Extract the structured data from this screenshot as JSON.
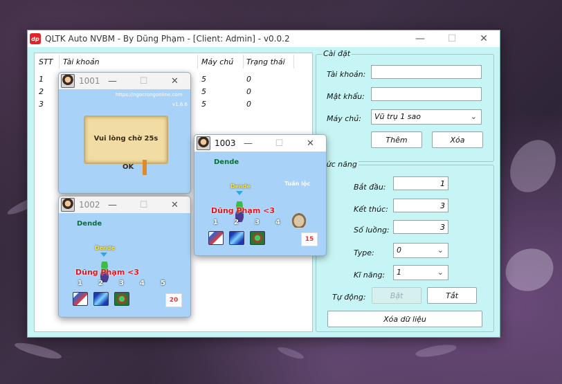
{
  "app": {
    "title": "QLTK Auto NVBM - By Dũng Phạm - [Client: Admin] - v0.0.2",
    "logo_text": "dp"
  },
  "table": {
    "columns": [
      "STT",
      "Tài khoản",
      "Máy chủ",
      "Trạng thái"
    ],
    "rows": [
      {
        "stt": "1",
        "account": "",
        "server": "5",
        "status": "0"
      },
      {
        "stt": "2",
        "account": "",
        "server": "5",
        "status": "0"
      },
      {
        "stt": "3",
        "account": "",
        "server": "5",
        "status": "0"
      }
    ]
  },
  "settings": {
    "title": "Cài đặt",
    "account_label": "Tài khoản:",
    "account_value": "",
    "password_label": "Mật khẩu:",
    "password_value": "",
    "server_label": "Máy chủ:",
    "server_value": "Vũ trụ 1 sao",
    "add_button": "Thêm",
    "delete_button": "Xóa"
  },
  "functions": {
    "title": "Chức năng",
    "start_label": "Bắt đầu:",
    "start_value": "1",
    "end_label": "Kết thúc:",
    "end_value": "3",
    "threads_label": "Số luồng:",
    "threads_value": "3",
    "type_label": "Type:",
    "type_value": "0",
    "skill_label": "Kĩ năng:",
    "skill_value": "1",
    "auto_label": "Tự động:",
    "on_button": "Bật",
    "off_button": "Tắt",
    "clear_button": "Xóa dữ liệu"
  },
  "game_windows": [
    {
      "title": "1001",
      "url": "https://ngocrongonline.com",
      "version": "v1.6.6",
      "dialog_text": "Vui lòng chờ 25s",
      "ok_label": "OK"
    },
    {
      "title": "1002",
      "npc_name": "Dende",
      "char_label": "Dende",
      "player_name": "Dũng Phạm <3",
      "slots": [
        "1",
        "2",
        "3",
        "4",
        "5"
      ],
      "counter": "20"
    },
    {
      "title": "1003",
      "npc_name": "Dende",
      "char_label": "Dende",
      "other_name": "Tuần lộc",
      "player_name": "Dũng Phạm <3",
      "slots": [
        "1",
        "2",
        "3",
        "4"
      ],
      "counter": "15"
    }
  ],
  "icons": {
    "minimize": "minimize-icon",
    "maximize": "maximize-icon",
    "close": "close-icon",
    "dropdown": "chevron-down-icon"
  }
}
